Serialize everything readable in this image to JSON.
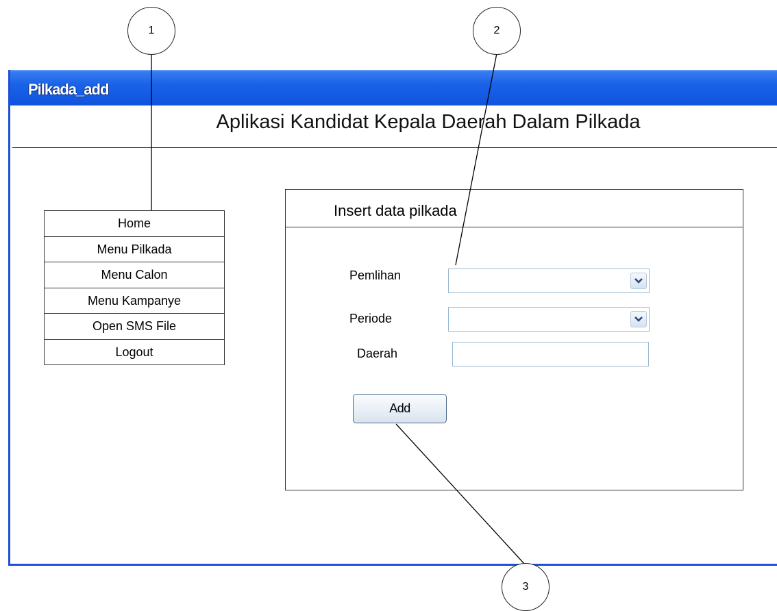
{
  "window": {
    "title": "Pilkada_add",
    "heading": "Aplikasi Kandidat Kepala Daerah Dalam Pilkada"
  },
  "sidebar": {
    "items": [
      {
        "label": "Home"
      },
      {
        "label": "Menu Pilkada"
      },
      {
        "label": "Menu Calon"
      },
      {
        "label": "Menu Kampanye"
      },
      {
        "label": "Open SMS File"
      },
      {
        "label": "Logout"
      }
    ]
  },
  "form": {
    "title": "Insert data pilkada",
    "fields": {
      "pemilihan": {
        "label": "Pemlihan",
        "value": ""
      },
      "periode": {
        "label": "Periode",
        "value": ""
      },
      "daerah": {
        "label": "Daerah",
        "value": ""
      }
    },
    "add_label": "Add"
  },
  "callouts": {
    "c1": "1",
    "c2": "2",
    "c3": "3"
  },
  "colors": {
    "titlebar": "#1862e8",
    "frame": "#1f4fd6",
    "field_border": "#98b6cf"
  },
  "icons": {
    "dropdown": "chevron-down-icon"
  }
}
